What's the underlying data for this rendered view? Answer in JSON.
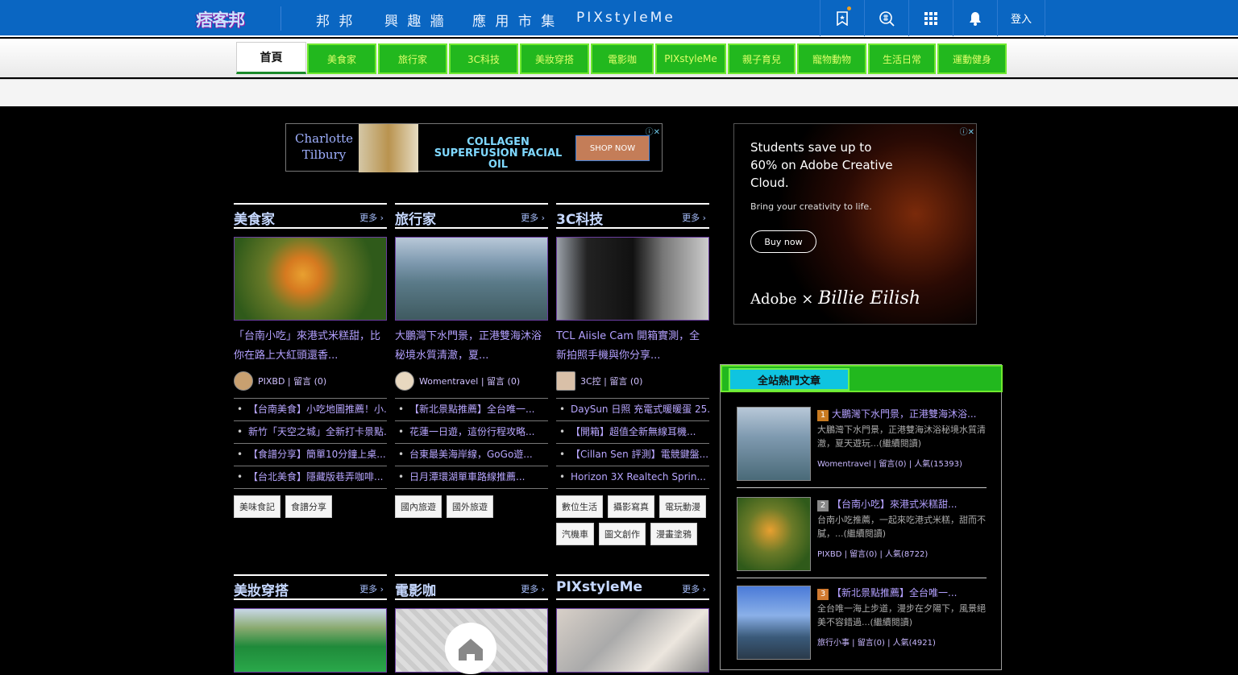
{
  "header": {
    "logo": "痞客邦",
    "nav": [
      "邦 邦",
      "興 趣 牆",
      "應 用 市 集",
      "PIXstyleMe"
    ],
    "login": "登入"
  },
  "categories": {
    "home": "首頁",
    "items": [
      "美食家",
      "旅行家",
      "3C科技",
      "美妝穿搭",
      "電影咖",
      "PIXstyleMe",
      "親子育兒",
      "寵物動物",
      "生活日常",
      "運動健身"
    ]
  },
  "ads": {
    "ad1": {
      "brand": "Charlotte Tilbury",
      "headline": "COLLAGEN SUPERFUSION FACIAL OIL",
      "cta": "SHOP NOW"
    },
    "ad2": {
      "headline": "Students save up to 60% on Adobe Creative Cloud.",
      "sub": "Bring your creativity to life.",
      "cta": "Buy now",
      "footer_left": "Adobe  ×",
      "footer_right": "Billie Eilish"
    }
  },
  "columns": [
    {
      "title": "美食家",
      "more": "更多",
      "post_title": "「台南小吃」來港式米糕甜，比你在路上大紅頭還香...",
      "author": "PIXBD",
      "comments": "留言 (0)",
      "list": [
        "【台南美食】小吃地圖推薦！小...",
        "新竹「天空之城」全新打卡景點...",
        "【食譜分享】簡單10分鐘上桌...",
        "【台北美食】隱藏版巷弄咖啡..."
      ],
      "tags": [
        "美味食記",
        "食譜分享"
      ]
    },
    {
      "title": "旅行家",
      "more": "更多",
      "post_title": "大鵬灣下水門景，正港雙海沐浴秘境水質清澈，夏...",
      "author": "Womentravel",
      "comments": "留言 (0)",
      "list": [
        "【新北景點推薦】全台唯一...",
        "花蓮一日遊，這份行程攻略...",
        "台東最美海岸線，GoGo遊...",
        "日月潭環湖單車路線推薦..."
      ],
      "tags": [
        "國內旅遊",
        "國外旅遊"
      ]
    },
    {
      "title": "3C科技",
      "more": "更多",
      "post_title": "TCL Aiisle Cam 開箱實測，全新拍照手機與你分享...",
      "author": "3C控",
      "comments": "留言 (0)",
      "list": [
        "DaySun 日照 充電式暖暖蛋 25...",
        "【開箱】超值全新無線耳機...",
        "【Cillan Sen 評測】電競鍵盤...",
        "Horizon 3X Realtech Sprin..."
      ],
      "tags": [
        "數位生活",
        "攝影寫真",
        "電玩動漫",
        "汽機車",
        "圖文創作",
        "漫畫塗鴉"
      ]
    }
  ],
  "columns_row2": [
    {
      "title": "美妝穿搭",
      "more": "更多"
    },
    {
      "title": "電影咖",
      "more": "更多"
    },
    {
      "title": "PIXstyleMe",
      "more": "更多"
    }
  ],
  "hot": {
    "tab": "全站熱門文章",
    "items": [
      {
        "title": "大鵬灣下水門景，正港雙海沐浴...",
        "desc": "大鵬灣下水門景，正港雙海沐浴秘境水質清澈，夏天遊玩...(繼續閱讀)",
        "meta": "Womentravel | 留言(0) | 人氣(15393)"
      },
      {
        "title": "【台南小吃】來港式米糕甜...",
        "desc": "台南小吃推薦，一起來吃港式米糕，甜而不膩，...(繼續閱讀)",
        "meta": "PIXBD | 留言(0) | 人氣(8722)"
      },
      {
        "title": "【新北景點推薦】全台唯一...",
        "desc": "全台唯一海上步道，漫步在夕陽下，風景絕美不容錯過...(繼續閱讀)",
        "meta": "旅行小事 | 留言(0) | 人氣(4921)"
      }
    ]
  }
}
